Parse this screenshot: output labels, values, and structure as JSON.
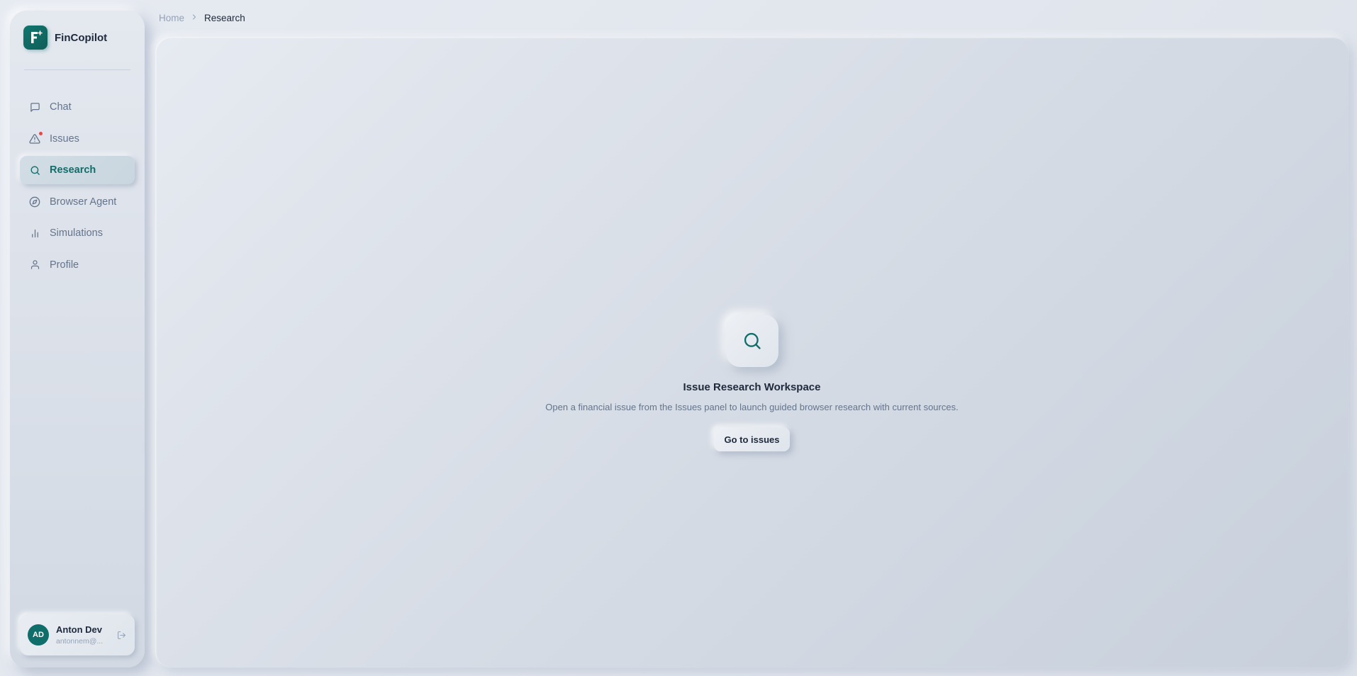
{
  "app": {
    "name": "FinCopilot",
    "accent_color": "#0f766e"
  },
  "sidebar": {
    "items": [
      {
        "label": "Chat",
        "icon": "message-square-icon",
        "active": false
      },
      {
        "label": "Issues",
        "icon": "alert-triangle-icon",
        "active": false,
        "has_notification": true
      },
      {
        "label": "Research",
        "icon": "search-icon",
        "active": true
      },
      {
        "label": "Browser Agent",
        "icon": "compass-icon",
        "active": false
      },
      {
        "label": "Simulations",
        "icon": "bar-chart-icon",
        "active": false
      },
      {
        "label": "Profile",
        "icon": "user-icon",
        "active": false
      }
    ]
  },
  "user": {
    "initials": "AD",
    "name": "Anton Dev",
    "email": "antonnem@..."
  },
  "breadcrumb": {
    "home": "Home",
    "current": "Research"
  },
  "empty_state": {
    "icon": "search-icon",
    "title": "Issue Research Workspace",
    "description": "Open a financial issue from the Issues panel to launch guided browser research with current sources.",
    "button_label": "Go to issues"
  }
}
